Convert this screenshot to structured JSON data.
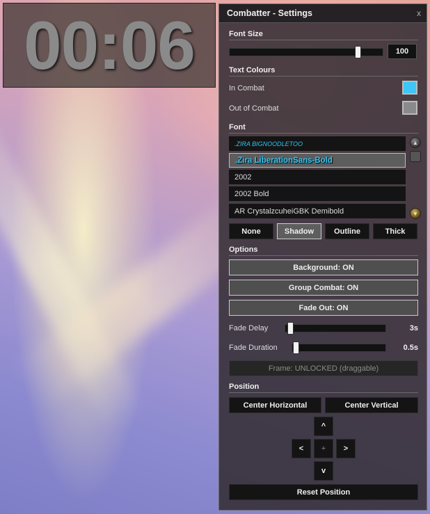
{
  "timer": {
    "value": "00:06"
  },
  "panel": {
    "title": "Combatter - Settings",
    "close_label": "x",
    "font_size": {
      "heading": "Font Size",
      "value": "100",
      "slider_fraction": 0.83
    },
    "text_colours": {
      "heading": "Text Colours",
      "in_combat": {
        "label": "In Combat",
        "color": "#3ec6f7"
      },
      "out_of_combat": {
        "label": "Out of Combat",
        "color": "#8a8a8a"
      }
    },
    "font": {
      "heading": "Font",
      "items": [
        ".ZIRA BIGNOODLETOO",
        ".Zira LiberationSans-Bold",
        "2002",
        "2002 Bold",
        "AR CrystalzcuheiGBK Demibold"
      ],
      "selected_index": 1,
      "outline_options": [
        "None",
        "Shadow",
        "Outline",
        "Thick"
      ],
      "selected_outline": "Shadow"
    },
    "options": {
      "heading": "Options",
      "background_label": "Background: ON",
      "group_combat_label": "Group Combat: ON",
      "fade_out_label": "Fade Out: ON",
      "fade_delay": {
        "label": "Fade Delay",
        "value": "3s",
        "slider_fraction": 0.05
      },
      "fade_duration": {
        "label": "Fade Duration",
        "value": "0.5s",
        "slider_fraction": 0.04
      },
      "frame_label": "Frame: UNLOCKED (draggable)"
    },
    "position": {
      "heading": "Position",
      "center_horizontal": "Center Horizontal",
      "center_vertical": "Center Vertical",
      "up": "^",
      "left": "<",
      "center": "+",
      "right": ">",
      "down": "v",
      "reset": "Reset Position"
    }
  }
}
